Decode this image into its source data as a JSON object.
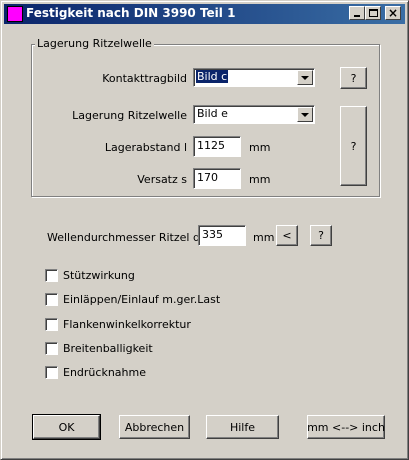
{
  "window": {
    "title": "Festigkeit nach DIN 3990 Teil 1",
    "minimize_label": "_",
    "close_label": "×"
  },
  "group": {
    "label": "Lagerung Ritzelwelle",
    "kontakttragbild_label": "Kontakttragbild",
    "kontakttragbild_value": "Bild c",
    "kontakttragbild_help": "?",
    "lagerung_label": "Lagerung Ritzelwelle",
    "lagerung_value": "Bild e",
    "lagerung_help": "?",
    "lagerabstand_label": "Lagerabstand l",
    "lagerabstand_value": "1125",
    "lagerabstand_unit": "mm",
    "versatz_label": "Versatz s",
    "versatz_value": "170",
    "versatz_unit": "mm"
  },
  "shaft": {
    "label": "Wellendurchmesser Ritzel dsh",
    "value": "335",
    "unit": "mm",
    "less_button": "<",
    "help_button": "?"
  },
  "options": [
    {
      "label": "Stützwirkung",
      "checked": false
    },
    {
      "label": "Einläppen/Einlauf m.ger.Last",
      "checked": false
    },
    {
      "label": "Flankenwinkelkorrektur",
      "checked": false
    },
    {
      "label": "Breitenballigkeit",
      "checked": false
    },
    {
      "label": "Endrücknahme",
      "checked": false
    }
  ],
  "buttons": {
    "ok": "OK",
    "cancel": "Abbrechen",
    "help": "Hilfe",
    "units": "mm <--> inch"
  }
}
